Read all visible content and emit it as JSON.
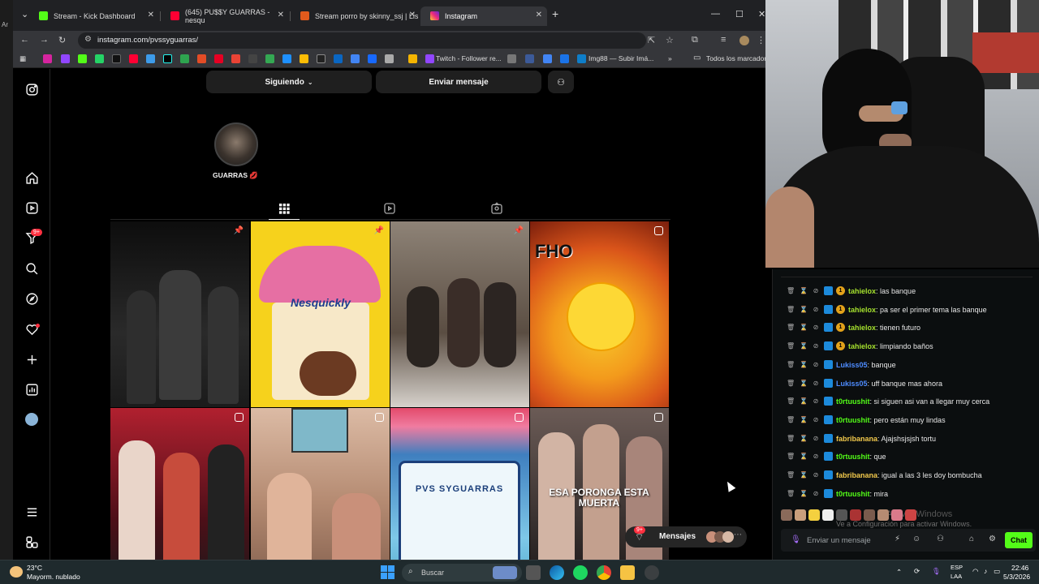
{
  "browser": {
    "tabs": [
      {
        "label": "Stream - Kick Dashboard",
        "color": "#53fc18"
      },
      {
        "label": "(645) PU$$Y GUARRAS - nesqu",
        "color": "#ff0033"
      },
      {
        "label": "Stream porro by skinny_ssj | Lis",
        "color": "#e05a1c"
      },
      {
        "label": "Instagram",
        "color": "#d6249f"
      }
    ],
    "url": "instagram.com/pvssyguarras/",
    "bookmarks": {
      "twitch_follower": "Twitch - Follower re...",
      "imgbb": "Img88 — Subir Imá...",
      "all_bookmarks": "Todos los marcadores"
    }
  },
  "instagram": {
    "following_label": "Siguiendo",
    "message_label": "Enviar mensaje",
    "highlight_label": "GUARRAS 💋",
    "notif_badge": "9+",
    "messages_badge": "9+",
    "messages_label": "Mensajes",
    "posts": [
      {
        "type": "pinned",
        "bg": "#1a1a1a"
      },
      {
        "type": "pinned",
        "caption": "Nesquickly",
        "bg": "#f6d21c"
      },
      {
        "type": "pinned",
        "bg": "#6d5a4a"
      },
      {
        "type": "reel",
        "caption": "FHO",
        "bg": "#e8641b"
      },
      {
        "type": "reel",
        "bg": "#8a1f2b"
      },
      {
        "type": "reel",
        "bg": "#b58b72"
      },
      {
        "type": "reel",
        "caption": "PVS SYGUARRAS",
        "bg": "#4ea7c9"
      },
      {
        "type": "reel",
        "caption": "ESA PORONGA ESTA MUERTA",
        "bg": "#3a3230"
      }
    ]
  },
  "chat": {
    "messages": [
      {
        "user": "tahielox",
        "text": "las banque",
        "user_color": "#a6e22e",
        "coin": true
      },
      {
        "user": "tahielox",
        "text": "pa ser el primer tema las banque",
        "user_color": "#a6e22e",
        "coin": true
      },
      {
        "user": "tahielox",
        "text": "tienen futuro",
        "user_color": "#a6e22e",
        "coin": true
      },
      {
        "user": "tahielox",
        "text": "limpiando baños",
        "user_color": "#a6e22e",
        "coin": true
      },
      {
        "user": "Lukiss05",
        "text": "banque",
        "user_color": "#4e8cff",
        "coin": false
      },
      {
        "user": "Lukiss05",
        "text": "uff banque mas ahora",
        "user_color": "#4e8cff",
        "coin": false
      },
      {
        "user": "t0rtuushit",
        "text": "si siguen asi van a llegar muy cerca",
        "user_color": "#53fc18",
        "coin": false
      },
      {
        "user": "t0rtuushit",
        "text": "pero están muy lindas",
        "user_color": "#53fc18",
        "coin": false
      },
      {
        "user": "fabribanana",
        "text": "Ajajshsjsjsh tortu",
        "user_color": "#f2c94c",
        "coin": false
      },
      {
        "user": "t0rtuushit",
        "text": "que",
        "user_color": "#53fc18",
        "coin": false
      },
      {
        "user": "fabribanana",
        "text": "igual a las 3 les doy bombucha",
        "user_color": "#f2c94c",
        "coin": false
      },
      {
        "user": "t0rtuushit",
        "text": "mira",
        "user_color": "#53fc18",
        "coin": false
      }
    ],
    "input_placeholder": "Enviar un mensaje",
    "send_label": "Chat",
    "watermark": "Ve a Configuración para activar Windows.",
    "watermark_title": "Activar Windows"
  },
  "taskbar": {
    "weather_temp": "23°C",
    "weather_desc": "Mayorm. nublado",
    "search_label": "Buscar",
    "lang_top": "ESP",
    "lang_bottom": "LAA",
    "time": "22:46",
    "date": "5/3/2026"
  }
}
